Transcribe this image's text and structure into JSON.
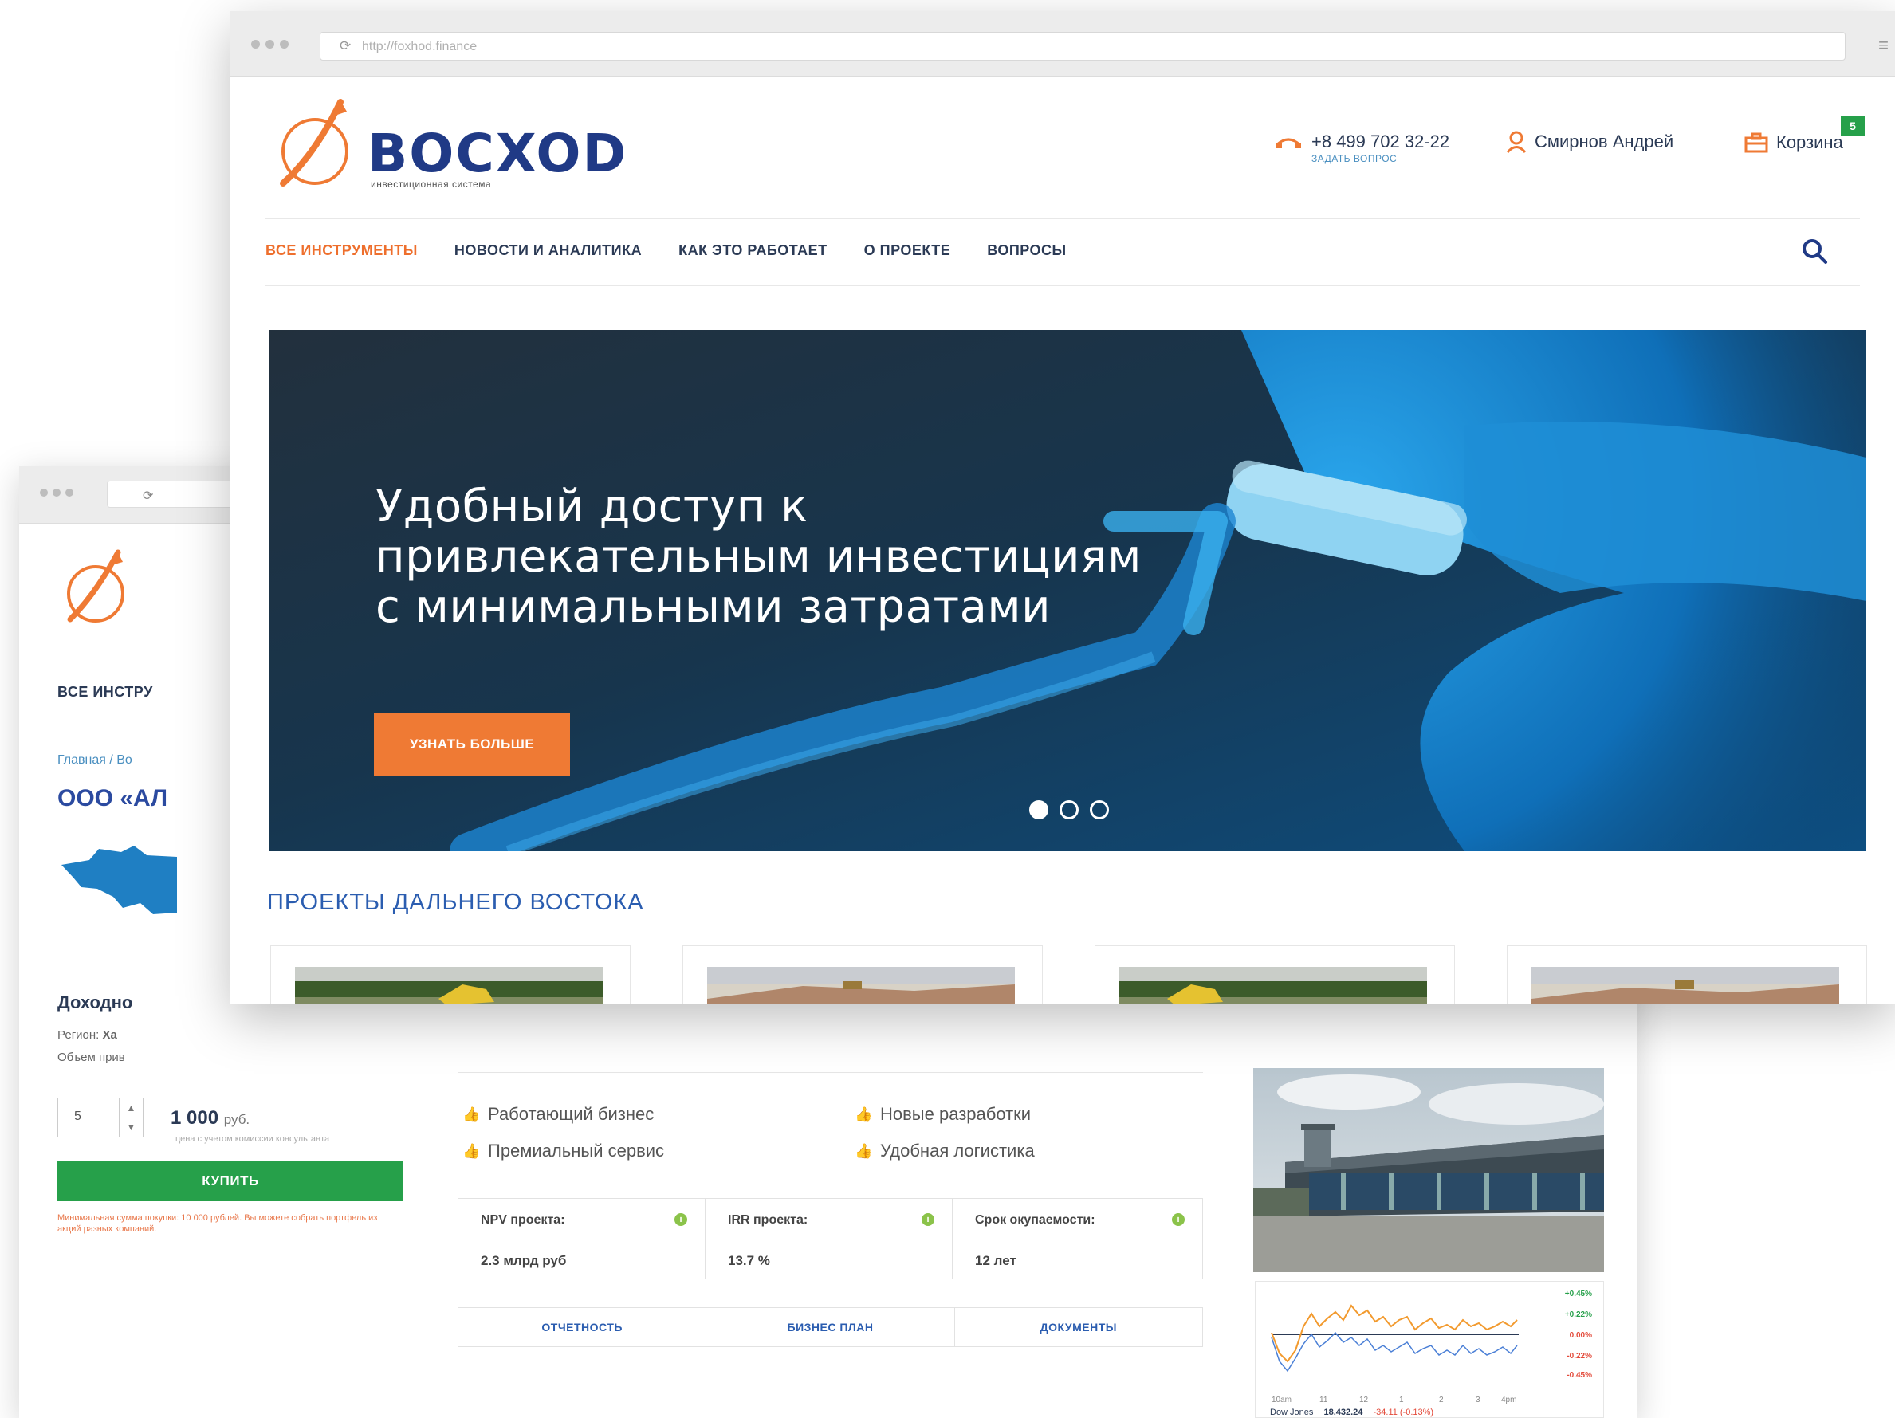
{
  "front": {
    "browser": {
      "url": "http://foxhod.finance"
    },
    "logo": {
      "name": "BOCXOD",
      "tagline": "инвестиционная система"
    },
    "header": {
      "phone": "+8 499 702 32-22",
      "ask_question": "ЗАДАТЬ ВОПРОС",
      "user_name": "Смирнов Андрей",
      "cart_label": "Корзина",
      "cart_count": "5"
    },
    "nav": [
      "ВСЕ ИНСТРУМЕНТЫ",
      "НОВОСТИ И АНАЛИТИКА",
      "КАК ЭТО РАБОТАЕТ",
      "О ПРОЕКТЕ",
      "ВОПРОСЫ"
    ],
    "hero": {
      "line1": "Удобный доступ к",
      "line2": "привлекательным инвестициям",
      "line3": "с минимальными затратами",
      "button": "УЗНАТЬ БОЛЬШЕ",
      "slides": 3,
      "active_slide": 1
    },
    "section_title": "ПРОЕКТЫ ДАЛЬНЕГО ВОСТОКА"
  },
  "back": {
    "nav_first": "ВСЕ ИНСТРУ",
    "breadcrumb": "Главная / Во",
    "title": "ООО «АЛ",
    "heading": "Доходно",
    "region_label": "Регион:",
    "region_value": "Ха",
    "volume_label": "Объем прив",
    "qty": "5",
    "price": "1 000",
    "price_unit": "руб.",
    "price_note": "цена с учетом комиссии консультанта",
    "buy": "КУПИТЬ",
    "min_note": "Минимальная сумма покупки: 10 000 рублей. Вы можете собрать портфель из акций разных компаний.",
    "features": [
      {
        "label": "Работающий бизнес",
        "icon": "thumb-up-icon",
        "color": "#ee7a33"
      },
      {
        "label": "Новые разработки",
        "icon": "thumb-up-icon",
        "color": "#ee7a33"
      },
      {
        "label": "Премиальный сервис",
        "icon": "thumb-up-icon",
        "color": "#2e6fc9"
      },
      {
        "label": "Удобная логистика",
        "icon": "thumb-up-icon",
        "color": "#26a04a"
      }
    ],
    "kpis": [
      {
        "label": "NPV проекта:",
        "value": "2.3 млрд руб"
      },
      {
        "label": "IRR проекта:",
        "value": "13.7 %"
      },
      {
        "label": "Срок окупаемости:",
        "value": "12 лет"
      }
    ],
    "tabs": [
      "ОТЧЕТНОСТЬ",
      "БИЗНЕС ПЛАН",
      "ДОКУМЕНТЫ"
    ],
    "stock": {
      "y_labels": [
        "+0.45%",
        "+0.22%",
        "0.00%",
        "-0.22%",
        "-0.45%"
      ],
      "x_labels": [
        "10am",
        "11",
        "12",
        "1",
        "2",
        "3",
        "4pm"
      ],
      "index_label": "Dow Jones",
      "index_value": "18,432.24",
      "index_change": "-34.11 (-0.13%)"
    }
  },
  "colors": {
    "brand_blue": "#203a86",
    "accent_orange": "#ef7a34",
    "buy_green": "#26a04a"
  }
}
